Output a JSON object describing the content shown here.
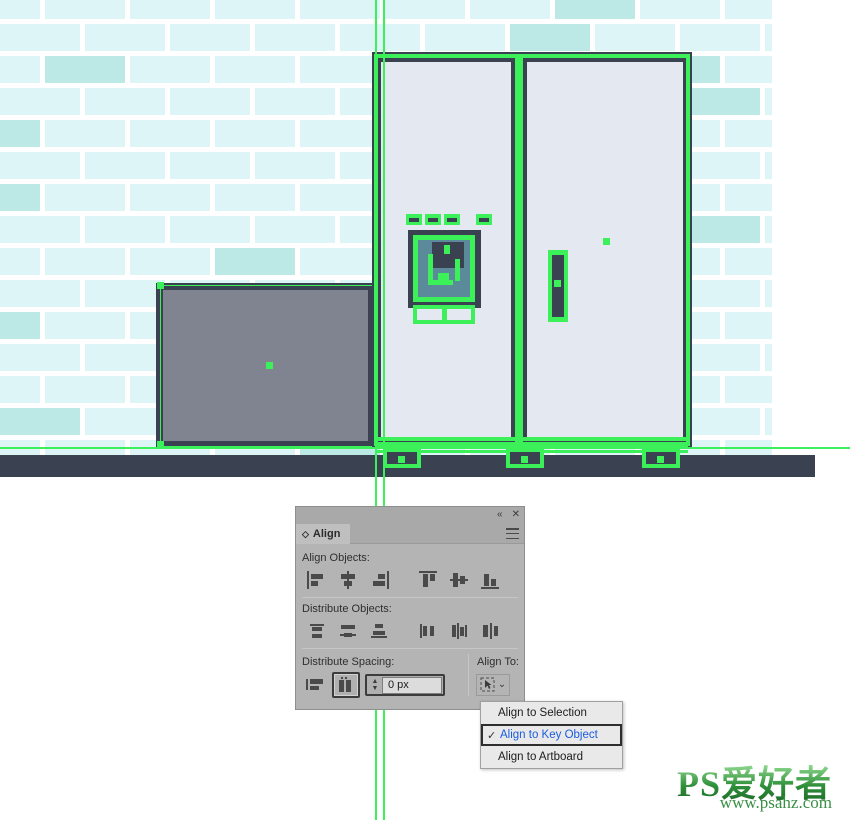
{
  "canvas": {
    "description": "Adobe Illustrator artboard with refrigerator vector artwork and green selection outlines",
    "colors": {
      "brick_light": "#ddf5f6",
      "brick_accent": "#bce8e6",
      "outline_dark": "#3a4151",
      "door_fill": "#e4e8f1",
      "counter_fill": "#808490",
      "selection_green": "#3cf05a",
      "dispenser_fill": "#5b8a9b"
    }
  },
  "panel": {
    "title": "Align",
    "tab_diamond_icon": "diamond-icon",
    "collapse_icon": "«",
    "close_icon": "✕",
    "menu_icon": "panel-menu-icon",
    "sections": {
      "align_objects_label": "Align Objects:",
      "distribute_objects_label": "Distribute Objects:",
      "distribute_spacing_label": "Distribute Spacing:",
      "align_to_label": "Align To:"
    },
    "align_objects_buttons": [
      {
        "name": "horizontal-align-left-icon"
      },
      {
        "name": "horizontal-align-center-icon"
      },
      {
        "name": "horizontal-align-right-icon"
      },
      {
        "name": "vertical-align-top-icon"
      },
      {
        "name": "vertical-align-center-icon"
      },
      {
        "name": "vertical-align-bottom-icon"
      }
    ],
    "distribute_objects_buttons": [
      {
        "name": "vertical-distribute-top-icon"
      },
      {
        "name": "vertical-distribute-center-icon"
      },
      {
        "name": "vertical-distribute-bottom-icon"
      },
      {
        "name": "horizontal-distribute-left-icon"
      },
      {
        "name": "horizontal-distribute-center-icon"
      },
      {
        "name": "horizontal-distribute-right-icon"
      }
    ],
    "distribute_spacing": {
      "vertical_button": "vertical-distribute-space-icon",
      "horizontal_button": "horizontal-distribute-space-icon",
      "horizontal_button_pressed": true,
      "spacing_value": "0 px",
      "spacing_placeholder": "0 px",
      "stepper_up": "▲",
      "stepper_down": "▼"
    },
    "align_to": {
      "button_icon": "align-to-key-object-icon",
      "chevron": "⌄"
    }
  },
  "align_to_menu": {
    "items": [
      {
        "label": "Align to Selection",
        "selected": false,
        "check": ""
      },
      {
        "label": "Align to Key Object",
        "selected": true,
        "check": "✓"
      },
      {
        "label": "Align to Artboard",
        "selected": false,
        "check": ""
      }
    ],
    "highlight_color": "#1a5ce0"
  },
  "watermark": {
    "title": "PS爱好者",
    "url": "www.psahz.com"
  }
}
